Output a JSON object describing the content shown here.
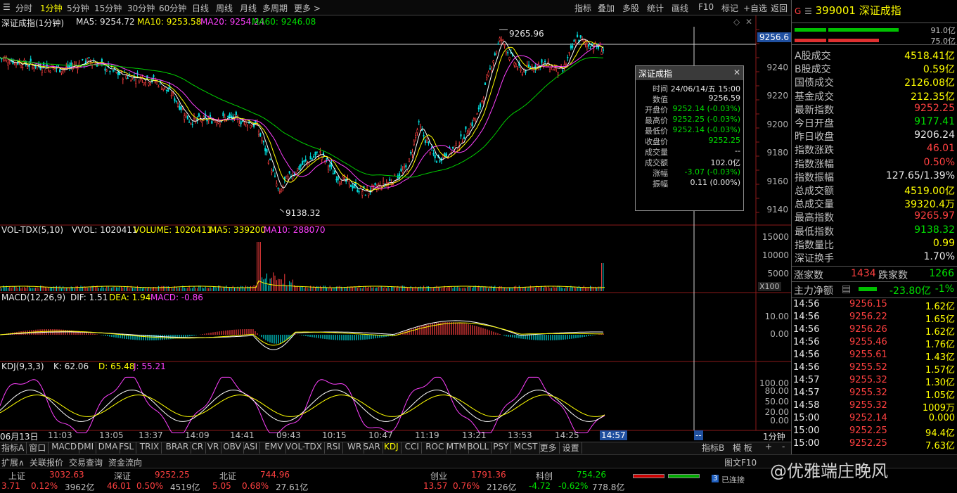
{
  "toolbar": {
    "periods": [
      "分时",
      "1分钟",
      "5分钟",
      "15分钟",
      "30分钟",
      "60分钟",
      "日线",
      "周线",
      "月线",
      "多周期",
      "更多 >"
    ],
    "active_period": "1分钟",
    "right": [
      "指标",
      "叠加",
      "多股",
      "统计",
      "画线",
      "F10",
      "标记",
      "+自选",
      "返回"
    ]
  },
  "header": {
    "name": "深证成指(1分钟)",
    "ma5": "MA5: 9254.72",
    "ma10": "MA10: 9253.58",
    "ma20": "MA20: 9254.24",
    "ma60": "MA60: 9246.08"
  },
  "price_axis": {
    "labels": [
      "9240",
      "9220",
      "9200",
      "9180",
      "9160",
      "9140"
    ],
    "cursor": "9256.6"
  },
  "annotations": {
    "high": "9265.96",
    "low": "9138.32"
  },
  "vol": {
    "header_name": "VOL-TDX(5,10)",
    "vvol": "VVOL: 1020411",
    "volume": "VOLUME: 1020411",
    "ma5": "MA5: 339200",
    "ma10": "MA10: 288070",
    "axis": [
      "15000",
      "10000",
      "5000"
    ],
    "unit": "X100"
  },
  "macd": {
    "name": "MACD(12,26,9)",
    "dif": "DIF: 1.51",
    "dea": "DEA: 1.94",
    "macd": "MACD: -0.86",
    "axis": [
      "10.00",
      "0.00"
    ]
  },
  "kdj": {
    "name": "KDJ(9,3,3)",
    "k": "K: 62.06",
    "d": "D: 65.48",
    "j": "J: 55.21",
    "axis": [
      "100.00",
      "80.00",
      "50.00",
      "20.00",
      "0.00"
    ]
  },
  "time_axis": {
    "labels": [
      "06月13日",
      "11:03",
      "13:05",
      "13:37",
      "14:09",
      "14:41",
      "09:43",
      "10:15",
      "10:47",
      "11:19",
      "13:21",
      "13:53",
      "14:25"
    ],
    "cursor": "14:57",
    "period": "1分钟"
  },
  "tabs": [
    "指标A",
    "窗口",
    "MACD",
    "DMI",
    "DMA",
    "FSL",
    "TRIX",
    "BRAR",
    "CR",
    "VR",
    "OBV",
    "ASI",
    "EMV",
    "VOL-TDX",
    "RSI",
    "WR",
    "SAR",
    "KDJ",
    "CCI",
    "ROC",
    "MTM",
    "BOLL",
    "PSY",
    "MCST",
    "更多",
    "设置"
  ],
  "tabs_right": [
    "指标B",
    "模 板",
    "+",
    "-"
  ],
  "tabs2": [
    "扩展∧",
    "关联报价",
    "交易查询",
    "资金流向"
  ],
  "popup": {
    "title": "深证成指",
    "rows": [
      {
        "l": "时间",
        "v": "24/06/14/五 15:00",
        "c": "white"
      },
      {
        "l": "数值",
        "v": "9256.59",
        "c": "white"
      },
      {
        "l": "开盘价",
        "v": "9252.14 (-0.03%)",
        "c": "green"
      },
      {
        "l": "最高价",
        "v": "9252.25 (-0.03%)",
        "c": "green"
      },
      {
        "l": "最低价",
        "v": "9252.14 (-0.03%)",
        "c": "green"
      },
      {
        "l": "收盘价",
        "v": "9252.25",
        "c": "green"
      },
      {
        "l": "成交量",
        "v": "--",
        "c": "white"
      },
      {
        "l": "成交额",
        "v": "102.0亿",
        "c": "white"
      },
      {
        "l": "涨幅",
        "v": "-3.07 (-0.03%)",
        "c": "green"
      },
      {
        "l": "振幅",
        "v": "0.11 (0.00%)",
        "c": "white"
      }
    ]
  },
  "right_panel": {
    "code": "399001",
    "name": "深证成指",
    "bar1": "91.0亿",
    "bar2": "75.0亿",
    "stats": [
      {
        "l": "A股成交",
        "v": "4518.41亿",
        "c": "yellow"
      },
      {
        "l": "B股成交",
        "v": "0.59亿",
        "c": "yellow"
      },
      {
        "l": "国债成交",
        "v": "2126.08亿",
        "c": "yellow"
      },
      {
        "l": "基金成交",
        "v": "212.35亿",
        "c": "yellow"
      },
      {
        "l": "最新指数",
        "v": "9252.25",
        "c": "red"
      },
      {
        "l": "今日开盘",
        "v": "9177.41",
        "c": "green"
      },
      {
        "l": "昨日收盘",
        "v": "9206.24",
        "c": "white"
      },
      {
        "l": "指数涨跌",
        "v": "46.01",
        "c": "red"
      },
      {
        "l": "指数涨幅",
        "v": "0.50%",
        "c": "red"
      },
      {
        "l": "指数振幅",
        "v": "127.65/1.39%",
        "c": "white"
      },
      {
        "l": "总成交额",
        "v": "4519.00亿",
        "c": "yellow"
      },
      {
        "l": "总成交量",
        "v": "39320.4万",
        "c": "yellow"
      },
      {
        "l": "最高指数",
        "v": "9265.97",
        "c": "red"
      },
      {
        "l": "最低指数",
        "v": "9138.32",
        "c": "green"
      },
      {
        "l": "指数量比",
        "v": "0.99",
        "c": "yellow"
      },
      {
        "l": "深证换手",
        "v": "1.70%",
        "c": "white"
      }
    ],
    "rise_label": "涨家数",
    "rise": "1434",
    "fall_label": "跌家数",
    "fall": "1266",
    "flow_label": "主力净额",
    "flow": "-23.80亿",
    "flow_pct": "-1%",
    "ticks": [
      {
        "t": "14:56",
        "p": "9256.15",
        "v": "1.62亿"
      },
      {
        "t": "14:56",
        "p": "9256.22",
        "v": "1.65亿"
      },
      {
        "t": "14:56",
        "p": "9256.26",
        "v": "1.62亿"
      },
      {
        "t": "14:56",
        "p": "9255.46",
        "v": "1.76亿"
      },
      {
        "t": "14:56",
        "p": "9255.61",
        "v": "1.43亿"
      },
      {
        "t": "14:56",
        "p": "9255.52",
        "v": "1.57亿"
      },
      {
        "t": "14:57",
        "p": "9255.32",
        "v": "1.30亿"
      },
      {
        "t": "14:57",
        "p": "9255.32",
        "v": "1.05亿"
      },
      {
        "t": "14:58",
        "p": "9255.32",
        "v": "1009万"
      },
      {
        "t": "15:00",
        "p": "9252.14",
        "v": "0.000"
      },
      {
        "t": "15:00",
        "p": "9252.25",
        "v": "94.4亿"
      },
      {
        "t": "15:00",
        "p": "9252.25",
        "v": "7.63亿"
      }
    ]
  },
  "bottom": {
    "items": [
      {
        "name": "上证",
        "price": "3032.63",
        "chg": "3.71",
        "pct": "0.12%",
        "amt": "3962亿",
        "up": true
      },
      {
        "name": "深证",
        "price": "9252.25",
        "chg": "46.01",
        "pct": "0.50%",
        "amt": "4519亿",
        "up": true
      },
      {
        "name": "北证",
        "price": "744.96",
        "chg": "5.05",
        "pct": "0.68%",
        "amt": "27.61亿",
        "up": true
      },
      {
        "name": "创业",
        "price": "1791.36",
        "chg": "13.57",
        "pct": "0.76%",
        "amt": "2126亿",
        "up": true
      },
      {
        "name": "科创",
        "price": "754.26",
        "chg": "-4.72",
        "pct": "-0.62%",
        "amt": "778.8亿",
        "up": false
      }
    ],
    "status": "已连接",
    "watermark": "@优雅端庄晚风",
    "figure_text": "图文F10"
  },
  "colors": {
    "up": "#ff4040",
    "down": "#00e000",
    "ma5": "#ffffff",
    "ma10": "#ffff00",
    "ma20": "#ff40ff",
    "ma60": "#00d000"
  }
}
